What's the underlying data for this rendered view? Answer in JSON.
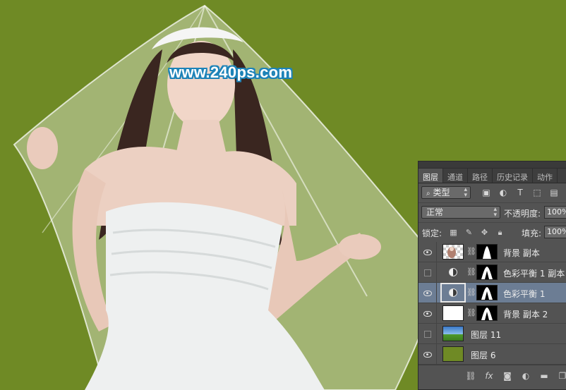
{
  "watermark": "www.240ps.com",
  "colors": {
    "background_green": "#6f8a25",
    "panel_bg": "#535353",
    "selected_row": "#6c7d94"
  },
  "layers_panel": {
    "tabs": [
      {
        "label": "图层",
        "active": true
      },
      {
        "label": "通道",
        "active": false
      },
      {
        "label": "路径",
        "active": false
      },
      {
        "label": "历史记录",
        "active": false
      },
      {
        "label": "动作",
        "active": false
      }
    ],
    "filter": {
      "icon": "search-icon",
      "value": "类型"
    },
    "filter_icons": [
      "image-filter-icon",
      "adjustment-filter-icon",
      "text-filter-icon",
      "shape-filter-icon",
      "smart-object-filter-icon"
    ],
    "blend_mode": "正常",
    "opacity_label": "不透明度:",
    "opacity_value": "100%",
    "lock_label": "锁定:",
    "fill_label": "填充:",
    "fill_value": "100%",
    "layers": [
      {
        "name": "背景 副本",
        "visible": true,
        "selected": false,
        "thumb": "checker-figure"
      },
      {
        "name": "色彩平衡 1 副本",
        "visible": false,
        "selected": false,
        "thumb": "adjustment"
      },
      {
        "name": "色彩平衡 1",
        "visible": true,
        "selected": true,
        "thumb": "adjustment"
      },
      {
        "name": "背景 副本 2",
        "visible": true,
        "selected": false,
        "thumb": "white"
      },
      {
        "name": "图层 11",
        "visible": false,
        "selected": false,
        "thumb": "sky"
      },
      {
        "name": "图层 6",
        "visible": true,
        "selected": false,
        "thumb": "green"
      }
    ],
    "footer_icons": [
      "link-icon",
      "fx-icon",
      "mask-icon",
      "adjustment-icon",
      "folder-icon",
      "new-layer-icon"
    ]
  }
}
